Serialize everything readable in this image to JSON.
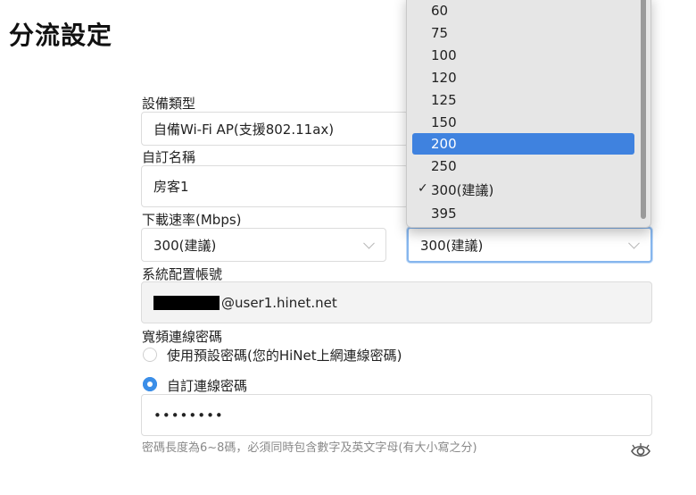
{
  "page": {
    "title": "分流設定"
  },
  "device_type": {
    "label": "設備類型",
    "value": "自備Wi-Fi AP(支援802.11ax)"
  },
  "custom_name": {
    "label": "自訂名稱",
    "value": "房客1"
  },
  "download_speed": {
    "label": "下載速率(Mbps)",
    "left_value": "300(建議)",
    "right_value": "300(建議)"
  },
  "account": {
    "label": "系統配置帳號",
    "suffix": "@user1.hinet.net"
  },
  "broadband_password": {
    "label": "寬頻連線密碼",
    "option_default": "使用預設密碼(您的HiNet上網連線密碼)",
    "option_custom": "自訂連線密碼",
    "selected": "custom",
    "password_mask": "••••••••",
    "hint": "密碼長度為6~8碼，必須同時包含數字及英文字母(有大小寫之分)"
  },
  "dropdown": {
    "options": [
      "60",
      "75",
      "100",
      "120",
      "125",
      "150",
      "200",
      "250",
      "300(建議)",
      "395"
    ],
    "highlighted": "200",
    "checked": "300(建議)",
    "check_mark": "✓"
  },
  "colors": {
    "accent": "#3b8ee8",
    "highlight": "#3f82df"
  },
  "icons": {
    "visibility": "eye-icon",
    "chevron": "chevron-down-icon"
  }
}
